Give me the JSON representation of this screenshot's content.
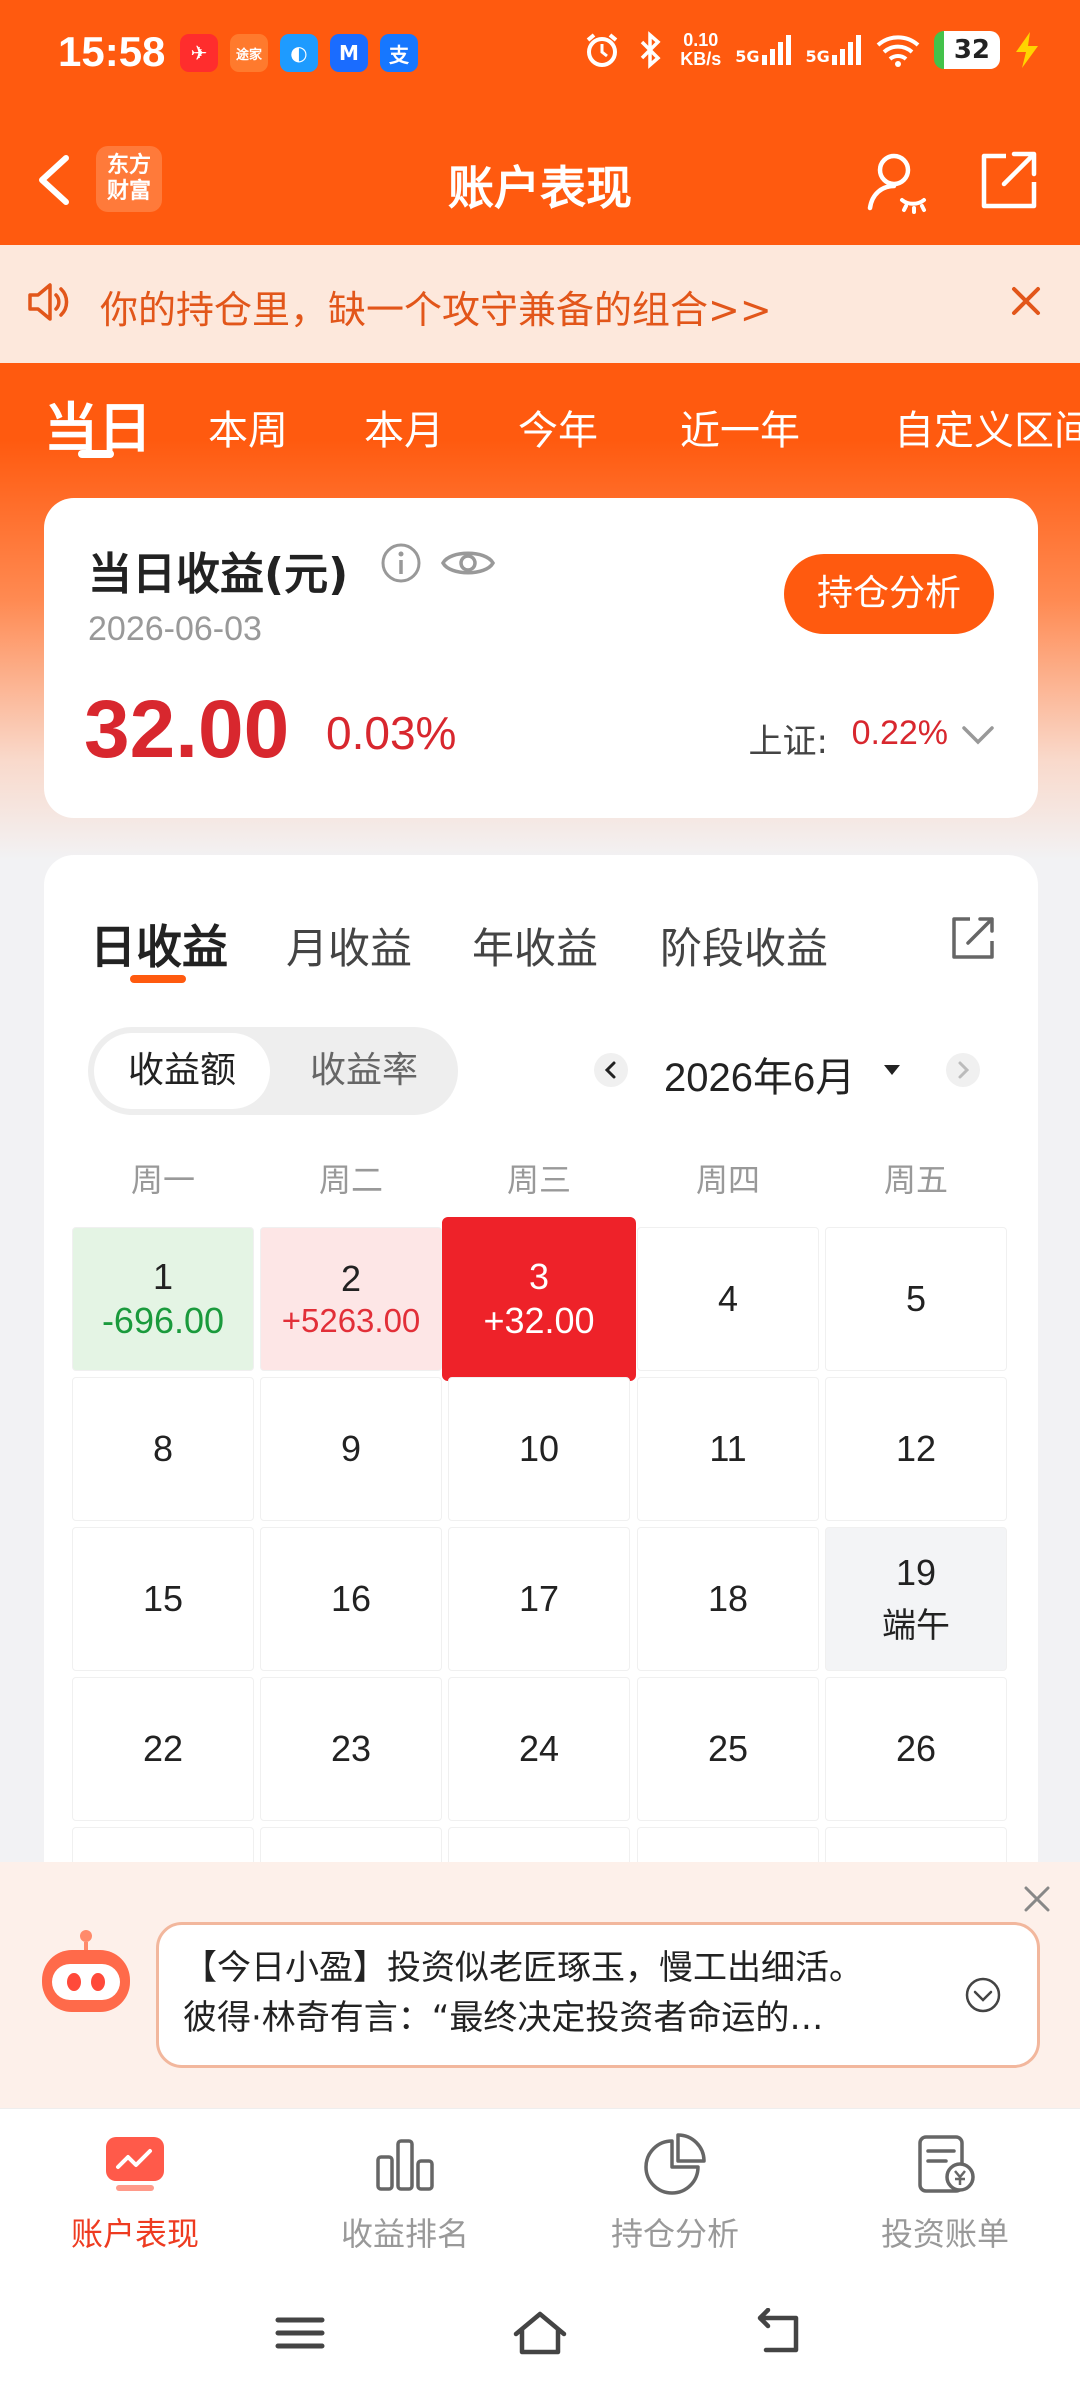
{
  "status": {
    "time": "15:58",
    "net_speed_top": "0.10",
    "net_speed_unit": "KB/s",
    "signal1": "5G",
    "signal2": "5G",
    "battery": "32",
    "apps": [
      "✈",
      "途家",
      "◐",
      "M",
      "支"
    ]
  },
  "nav": {
    "brand_line1": "东方",
    "brand_line2": "财富",
    "title": "账户表现"
  },
  "notice": {
    "text": "你的持仓里，缺一个攻守兼备的组合>>"
  },
  "period_tabs": [
    "当日",
    "本周",
    "本月",
    "今年",
    "近一年",
    "自定义区间"
  ],
  "summary": {
    "label": "当日收益(元)",
    "date": "2026-06-03",
    "amount": "32.00",
    "percent": "0.03%",
    "holding_button": "持仓分析",
    "index_label": "上证:",
    "index_value": "0.22%"
  },
  "returns_tabs": [
    "日收益",
    "月收益",
    "年收益",
    "阶段收益"
  ],
  "toggle": [
    "收益额",
    "收益率"
  ],
  "calendar": {
    "month_label": "2026年6月",
    "weekdays": [
      "周一",
      "周二",
      "周三",
      "周四",
      "周五"
    ],
    "weeks": [
      [
        {
          "day": "1",
          "value": "-696.00",
          "type": "loss"
        },
        {
          "day": "2",
          "value": "+5263.00",
          "type": "gain"
        },
        {
          "day": "3",
          "value": "+32.00",
          "type": "today"
        },
        {
          "day": "4",
          "value": "",
          "type": "normal"
        },
        {
          "day": "5",
          "value": "",
          "type": "normal"
        }
      ],
      [
        {
          "day": "8",
          "value": "",
          "type": "normal"
        },
        {
          "day": "9",
          "value": "",
          "type": "normal"
        },
        {
          "day": "10",
          "value": "",
          "type": "normal"
        },
        {
          "day": "11",
          "value": "",
          "type": "normal"
        },
        {
          "day": "12",
          "value": "",
          "type": "normal"
        }
      ],
      [
        {
          "day": "15",
          "value": "",
          "type": "normal"
        },
        {
          "day": "16",
          "value": "",
          "type": "normal"
        },
        {
          "day": "17",
          "value": "",
          "type": "normal"
        },
        {
          "day": "18",
          "value": "",
          "type": "normal"
        },
        {
          "day": "19",
          "value": "端午",
          "type": "holiday"
        }
      ],
      [
        {
          "day": "22",
          "value": "",
          "type": "normal"
        },
        {
          "day": "23",
          "value": "",
          "type": "normal"
        },
        {
          "day": "24",
          "value": "",
          "type": "normal"
        },
        {
          "day": "25",
          "value": "",
          "type": "normal"
        },
        {
          "day": "26",
          "value": "",
          "type": "normal"
        }
      ]
    ]
  },
  "ai": {
    "line1": "【今日小盈】投资似老匠琢玉，慢工出细活。",
    "line2": "彼得·林奇有言：“最终决定投资者命运的…"
  },
  "bottom_nav": [
    "账户表现",
    "收益排名",
    "持仓分析",
    "投资账单"
  ],
  "colors": {
    "brand": "#ff5a0f",
    "gain": "#e22f38",
    "loss": "#1a9a3c",
    "today": "#ee2229"
  }
}
